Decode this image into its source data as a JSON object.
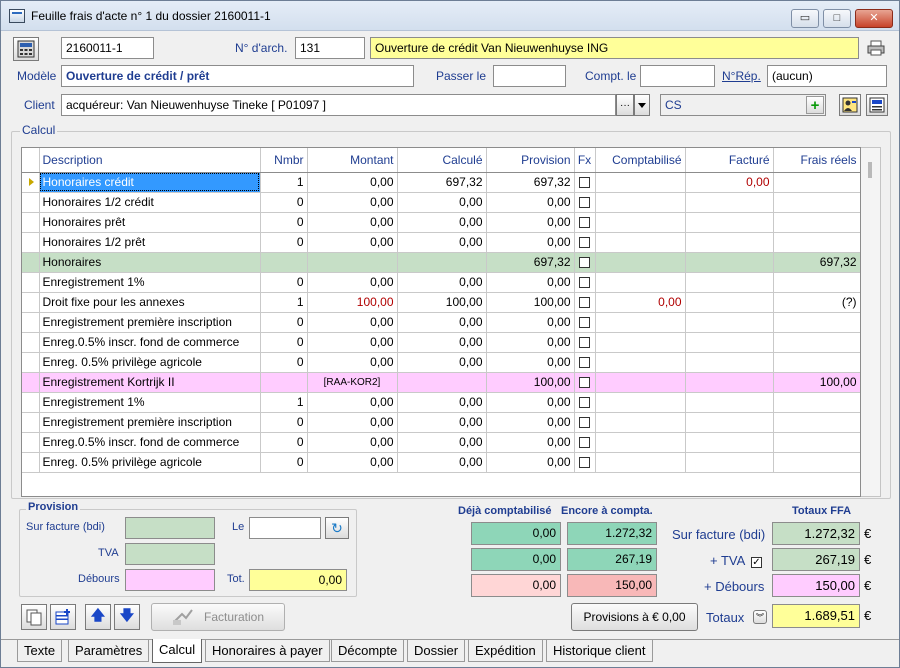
{
  "window": {
    "title": "Feuille frais d'acte n° 1 du dossier 2160011-1"
  },
  "header": {
    "dossier": "2160011-1",
    "narch_label": "N° d'arch.",
    "narch_value": "131",
    "subject": "Ouverture de crédit Van Nieuwenhuyse ING",
    "modele_label": "Modèle",
    "modele_value": "Ouverture de crédit / prêt",
    "passer_label": "Passer le",
    "passer_value": "",
    "compt_label": "Compt. le",
    "compt_value": "",
    "nrep_label": "N°Rép.",
    "nrep_value": "(aucun)",
    "client_label": "Client",
    "client_value": "acquéreur: Van Nieuwenhuyse Tineke [ P01097 ]",
    "client_ellipsis": "···",
    "cs_value": "CS",
    "plus_glyph": "+"
  },
  "calc": {
    "group_label": "Calcul",
    "columns": [
      "Description",
      "Nmbr",
      "Montant",
      "Calculé",
      "Provision",
      "Fx",
      "Comptabilisé",
      "Facturé",
      "Frais réels"
    ],
    "rows": [
      {
        "desc": "Honoraires crédit",
        "nmbr": "1",
        "montant": "0,00",
        "calcule": "697,32",
        "provision": "697,32",
        "fx": false,
        "compta": "",
        "facture": "0,00",
        "frais": "",
        "style": "sel"
      },
      {
        "desc": "Honoraires 1/2 crédit",
        "nmbr": "0",
        "montant": "0,00",
        "calcule": "0,00",
        "provision": "0,00",
        "fx": false,
        "compta": "",
        "facture": "",
        "frais": "",
        "style": ""
      },
      {
        "desc": "Honoraires prêt",
        "nmbr": "0",
        "montant": "0,00",
        "calcule": "0,00",
        "provision": "0,00",
        "fx": false,
        "compta": "",
        "facture": "",
        "frais": "",
        "style": ""
      },
      {
        "desc": "Honoraires 1/2 prêt",
        "nmbr": "0",
        "montant": "0,00",
        "calcule": "0,00",
        "provision": "0,00",
        "fx": false,
        "compta": "",
        "facture": "",
        "frais": "",
        "style": ""
      },
      {
        "desc": "Honoraires",
        "nmbr": "",
        "montant": "",
        "calcule": "",
        "provision": "697,32",
        "fx": false,
        "compta": "",
        "facture": "",
        "frais": "697,32",
        "style": "green"
      },
      {
        "desc": "Enregistrement 1%",
        "nmbr": "0",
        "montant": "0,00",
        "calcule": "0,00",
        "provision": "0,00",
        "fx": false,
        "compta": "",
        "facture": "",
        "frais": "",
        "style": ""
      },
      {
        "desc": "Droit fixe pour les annexes",
        "nmbr": "1",
        "montant": "100,00",
        "calcule": "100,00",
        "provision": "100,00",
        "fx": false,
        "compta": "0,00",
        "facture": "",
        "frais": "(?)",
        "style": "",
        "montant_red": true,
        "compta_red": true
      },
      {
        "desc": "Enregistrement première inscription",
        "nmbr": "0",
        "montant": "0,00",
        "calcule": "0,00",
        "provision": "0,00",
        "fx": false,
        "compta": "",
        "facture": "",
        "frais": "",
        "style": ""
      },
      {
        "desc": "Enreg.0.5% inscr. fond de commerce",
        "nmbr": "0",
        "montant": "0,00",
        "calcule": "0,00",
        "provision": "0,00",
        "fx": false,
        "compta": "",
        "facture": "",
        "frais": "",
        "style": ""
      },
      {
        "desc": "Enreg. 0.5% privilège agricole",
        "nmbr": "0",
        "montant": "0,00",
        "calcule": "0,00",
        "provision": "0,00",
        "fx": false,
        "compta": "",
        "facture": "",
        "frais": "",
        "style": ""
      },
      {
        "desc": "Enregistrement Kortrijk II",
        "nmbr": "",
        "montant": "[RAA-KOR2]",
        "calcule": "",
        "provision": "100,00",
        "fx": false,
        "compta": "",
        "facture": "",
        "frais": "100,00",
        "style": "pink",
        "montant_center": true
      },
      {
        "desc": "Enregistrement 1%",
        "nmbr": "1",
        "montant": "0,00",
        "calcule": "0,00",
        "provision": "0,00",
        "fx": false,
        "compta": "",
        "facture": "",
        "frais": "",
        "style": ""
      },
      {
        "desc": "Enregistrement première inscription",
        "nmbr": "0",
        "montant": "0,00",
        "calcule": "0,00",
        "provision": "0,00",
        "fx": false,
        "compta": "",
        "facture": "",
        "frais": "",
        "style": ""
      },
      {
        "desc": "Enreg.0.5% inscr. fond de commerce",
        "nmbr": "0",
        "montant": "0,00",
        "calcule": "0,00",
        "provision": "0,00",
        "fx": false,
        "compta": "",
        "facture": "",
        "frais": "",
        "style": ""
      },
      {
        "desc": "Enreg. 0.5% privilège agricole",
        "nmbr": "0",
        "montant": "0,00",
        "calcule": "0,00",
        "provision": "0,00",
        "fx": false,
        "compta": "",
        "facture": "",
        "frais": "",
        "style": ""
      }
    ]
  },
  "provision": {
    "group_label": "Provision",
    "sur_facture_label": "Sur facture (bdi)",
    "sur_facture_value": "",
    "tva_label": "TVA",
    "tva_value": "",
    "debours_label": "Débours",
    "debours_value": "",
    "le_label": "Le",
    "le_value": "",
    "tot_label": "Tot.",
    "tot_value": "0,00"
  },
  "totals": {
    "deja_label": "Déjà comptabilisé",
    "encore_label": "Encore à compta.",
    "ffa_label": "Totaux FFA",
    "deja": [
      "0,00",
      "0,00",
      "0,00"
    ],
    "encore": [
      "1.272,32",
      "267,19",
      "150,00"
    ],
    "sur_facture_label": "Sur facture (bdi)",
    "tva_label": "+ TVA",
    "tva_checked": true,
    "debours_label": "+ Débours",
    "ffa": [
      "1.272,32",
      "267,19",
      "150,00"
    ],
    "currency": "€",
    "totaux_label": "Totaux",
    "total_value": "1.689,51"
  },
  "buttons": {
    "facturation": "Facturation",
    "provisions": "Provisions à € 0,00"
  },
  "tabs": [
    "Texte",
    "Paramètres",
    "Calcul",
    "Honoraires à payer",
    "Décompte",
    "Dossier",
    "Expédition",
    "Historique client"
  ],
  "active_tab": "Calcul",
  "colors": {
    "accent": "#1f3d91",
    "green_row": "#c6dfc6",
    "pink_row": "#ffccff",
    "highlight": "#ffff99",
    "selection": "#3399ff"
  }
}
